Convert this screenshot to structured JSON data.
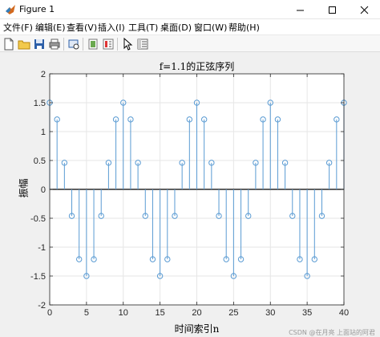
{
  "window": {
    "title": "Figure 1"
  },
  "menu": [
    "文件(F)",
    "编辑(E)",
    "查看(V)",
    "插入(I)",
    "工具(T)",
    "桌面(D)",
    "窗口(W)",
    "帮助(H)"
  ],
  "toolbar_icons": [
    "new-figure-icon",
    "open-file-icon",
    "save-icon",
    "print-icon",
    "print-preview-icon",
    "link-plot-icon",
    "colorbar-icon",
    "legend-icon",
    "pointer-icon",
    "property-inspector-icon"
  ],
  "colors": {
    "stem": "#5a9bd3",
    "axes_bg": "#ffffff",
    "figure_bg": "#f0f0f0",
    "grid": "#e6e6e6"
  },
  "watermark": "CSDN @在月亮 上面站的阿君",
  "chart_data": {
    "type": "stem",
    "title": "f=1.1的正弦序列",
    "xlabel": "时间索引n",
    "ylabel": "振幅",
    "xlim": [
      0,
      40
    ],
    "ylim": [
      -2,
      2
    ],
    "xticks": [
      0,
      5,
      10,
      15,
      20,
      25,
      30,
      35,
      40
    ],
    "yticks": [
      -2,
      -1.5,
      -1,
      -0.5,
      0,
      0.5,
      1,
      1.5,
      2
    ],
    "grid": true,
    "x": [
      0,
      1,
      2,
      3,
      4,
      5,
      6,
      7,
      8,
      9,
      10,
      11,
      12,
      13,
      14,
      15,
      16,
      17,
      18,
      19,
      20,
      21,
      22,
      23,
      24,
      25,
      26,
      27,
      28,
      29,
      30,
      31,
      32,
      33,
      34,
      35,
      36,
      37,
      38,
      39,
      40
    ],
    "y": [
      1.5,
      1.21,
      0.46,
      -0.46,
      -1.21,
      -1.5,
      -1.21,
      -0.46,
      0.46,
      1.21,
      1.5,
      1.21,
      0.46,
      -0.46,
      -1.21,
      -1.5,
      -1.21,
      -0.46,
      0.46,
      1.21,
      1.5,
      1.21,
      0.46,
      -0.46,
      -1.21,
      -1.5,
      -1.21,
      -0.46,
      0.46,
      1.21,
      1.5,
      1.21,
      0.46,
      -0.46,
      -1.21,
      -1.5,
      -1.21,
      -0.46,
      0.46,
      1.21,
      1.5
    ]
  }
}
